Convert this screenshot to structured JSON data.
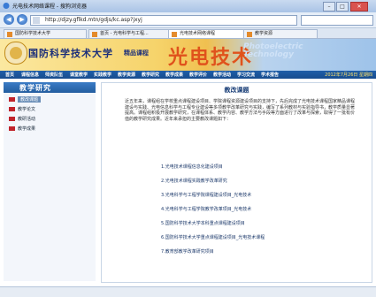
{
  "window": {
    "title": "光电技术网络课程 - 搜狗浏览器"
  },
  "toolbar": {
    "back_label": "◀",
    "forward_label": "▶",
    "url": "http://djzy.gflkd.mtn/gdjs/kc.asp?jxyj",
    "search_placeholder": ""
  },
  "tabs": [
    {
      "label": "国防科学技术大学"
    },
    {
      "label": "首页 - 光电科学与工程..."
    },
    {
      "label": "光电技术网络课程"
    },
    {
      "label": "教学资源"
    }
  ],
  "banner": {
    "school": "国防科学技术大学",
    "tag": "精品课程",
    "course": "光电技术",
    "english_line1": "Photoelectric",
    "english_line2": "Technology"
  },
  "menu": {
    "items": [
      "首页",
      "课程信息",
      "师资队伍",
      "课堂教学",
      "实践教学",
      "教学资源",
      "教学研究",
      "教学成果",
      "教学评价",
      "教学活动",
      "学习交流",
      "学术报告"
    ],
    "date": "2012年7月26日 星期四"
  },
  "sidebar": {
    "title": "教学研究",
    "items": [
      {
        "label": "教改课题"
      },
      {
        "label": "教学论文"
      },
      {
        "label": "教研活动"
      },
      {
        "label": "教学成果"
      }
    ]
  },
  "main": {
    "title": "教改课题",
    "paragraph": "近五年来，课程组在学校重点课程建设项目、学院课程资源建设项目的支持下，先后完成了光电技术课程国家精品课程建设与实践、光电信息科学与工程专业建设等多项教学改革研究与实践，编写了系列教材与实验指导书，教学质量显著提高。课程组积极开展教学研究，在课程体系、教学内容、教学方法与手段等方面进行了改革与探索，取得了一批有价值的教学研究成果。近年来承担的主要教改课题如下：",
    "list": [
      "1.光电技术课程信息化建设项目",
      "2.光电技术课程实践教学改革研究",
      "3.光电科学与工程学院课程建设项目_光电技术",
      "4.光电科学与工程学院教学改革项目_光电技术",
      "5.国防科学技术大学本科重点课程建设项目",
      "6.国防科学技术大学重点课程建设项目_光电技术课程",
      "7.教育部教学改革研究项目"
    ]
  }
}
